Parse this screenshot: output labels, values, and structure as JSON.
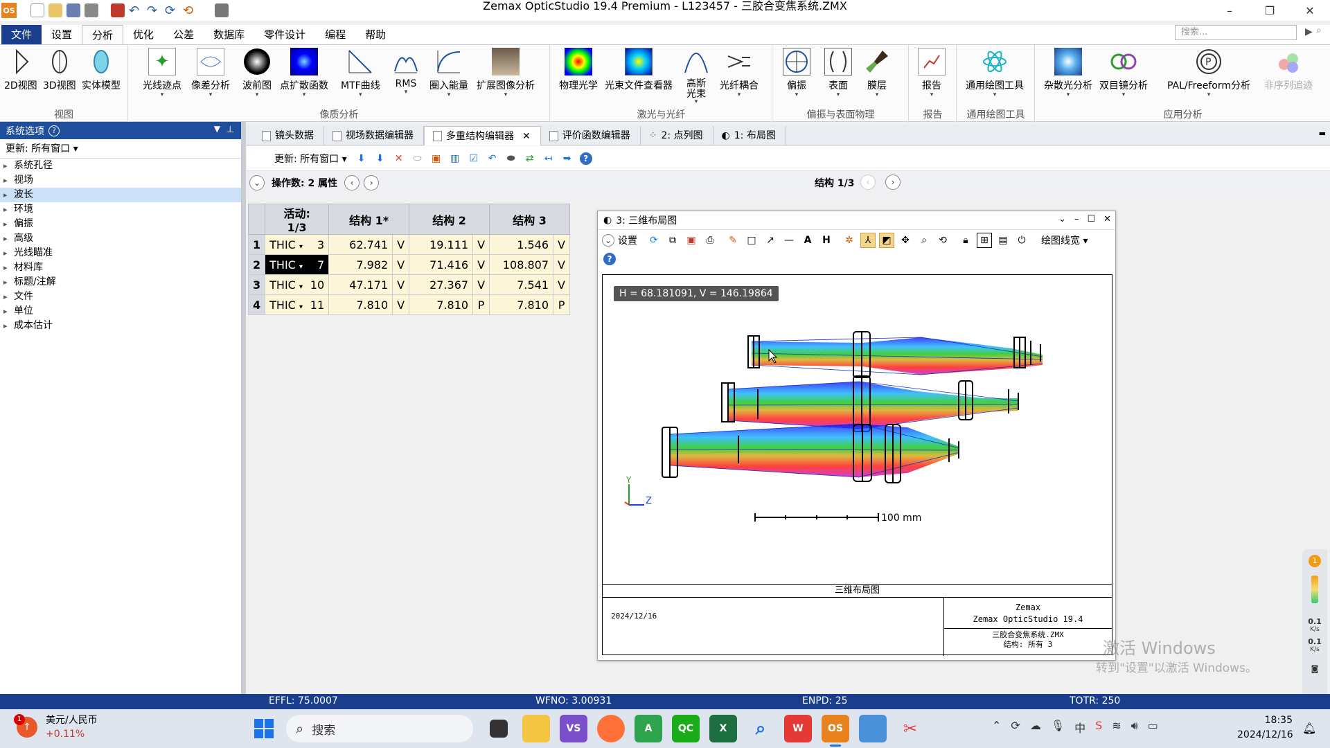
{
  "window": {
    "app_badge": "OS",
    "title": "Zemax OpticStudio 19.4    Premium - L123457 - 三胶合变焦系统.ZMX",
    "min": "–",
    "restore": "❐",
    "close": "✕"
  },
  "menu": {
    "items": [
      "文件",
      "设置",
      "分析",
      "优化",
      "公差",
      "数据库",
      "零件设计",
      "编程",
      "帮助"
    ],
    "active": "分析",
    "search_placeholder": "搜索..."
  },
  "ribbon": {
    "groups": [
      {
        "label": "视图",
        "buttons": [
          "2D视图",
          "3D视图",
          "实体模型"
        ]
      },
      {
        "label": "像质分析",
        "buttons": [
          "光线迹点",
          "像差分析",
          "波前图",
          "点扩散函数",
          "MTF曲线",
          "RMS",
          "圈入能量",
          "扩展图像分析"
        ]
      },
      {
        "label": "激光与光纤",
        "buttons": [
          "物理光学",
          "光束文件查看器",
          "高斯光束",
          "光纤耦合"
        ]
      },
      {
        "label": "偏振与表面物理",
        "buttons": [
          "偏振",
          "表面",
          "膜层"
        ]
      },
      {
        "label": "报告",
        "buttons": [
          "报告"
        ]
      },
      {
        "label": "通用绘图工具",
        "buttons": [
          "通用绘图工具"
        ]
      },
      {
        "label": "应用分析",
        "buttons": [
          "杂散光分析",
          "双目镜分析",
          "PAL/Freeform分析",
          "非序列追迹"
        ]
      }
    ],
    "gauss_line1": "高斯",
    "gauss_line2": "光束"
  },
  "left_panel": {
    "header": "系统选项",
    "update_label": "更新: 所有窗口",
    "items": [
      "系统孔径",
      "视场",
      "波长",
      "环境",
      "偏振",
      "高级",
      "光线瞄准",
      "材料库",
      "标题/注解",
      "文件",
      "单位",
      "成本估计"
    ],
    "selected": "波长"
  },
  "doc_tabs": [
    "镜头数据",
    "视场数据编辑器",
    "多重结构编辑器",
    "评价函数编辑器",
    "2: 点列图",
    "1: 布局图"
  ],
  "active_tab": "多重结构编辑器",
  "mce": {
    "update_label": "更新: 所有窗口",
    "operands_label": "操作数:  2 属性",
    "config_label": "结构 1/3",
    "headers": [
      "活动: 1/3",
      "结构 1*",
      "结构 2",
      "结构 3"
    ],
    "rows": [
      {
        "n": "1",
        "op": "THIC",
        "surf": "3",
        "c1": "62.741",
        "f1": "V",
        "c2": "19.111",
        "f2": "V",
        "c3": "1.546",
        "f3": "V"
      },
      {
        "n": "2",
        "op": "THIC",
        "surf": "7",
        "c1": "7.982",
        "f1": "V",
        "c2": "71.416",
        "f2": "V",
        "c3": "108.807",
        "f3": "V"
      },
      {
        "n": "3",
        "op": "THIC",
        "surf": "10",
        "c1": "47.171",
        "f1": "V",
        "c2": "27.367",
        "f2": "V",
        "c3": "7.541",
        "f3": "V"
      },
      {
        "n": "4",
        "op": "THIC",
        "surf": "11",
        "c1": "7.810",
        "f1": "V",
        "c2": "7.810",
        "f2": "P",
        "c3": "7.810",
        "f3": "P"
      }
    ]
  },
  "layout_window": {
    "title": "3: 三维布局图",
    "settings_label": "设置",
    "linewidth_label": "绘图线宽",
    "coord_readout": "H = 68.181091, V = 146.19864",
    "scale_label": "100 mm",
    "axis_y": "Y",
    "axis_z": "Z",
    "caption": "三维布局图",
    "date": "2024/12/16",
    "vendor": "Zemax",
    "product": "Zemax OpticStudio 19.4",
    "file": "三胶合变焦系统.ZMX",
    "config": "结构: 所有 3"
  },
  "status": {
    "effl": "EFFL: 75.0007",
    "wfno": "WFNO: 3.00931",
    "enpd": "ENPD: 25",
    "totr": "TOTR: 250"
  },
  "watermark": {
    "line1": "激活 Windows",
    "line2": "转到\"设置\"以激活 Windows。"
  },
  "side_widget": {
    "badge": "1",
    "up_value": "0.1",
    "up_unit": "K/s",
    "down_value": "0.1",
    "down_unit": "K/s"
  },
  "taskbar": {
    "weather_title": "美元/人民币",
    "weather_sub": "+0.11%",
    "weather_badge": "1",
    "search_label": "搜索",
    "ime": "中",
    "time": "18:35",
    "date": "2024/12/16"
  }
}
